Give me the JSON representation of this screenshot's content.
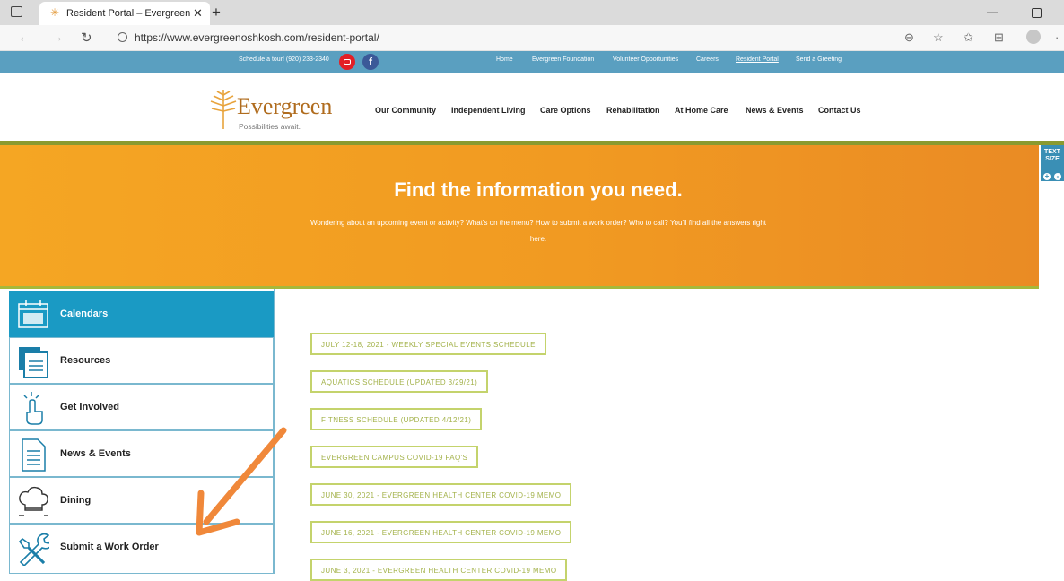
{
  "browser": {
    "tab_title": "Resident Portal – Evergreen",
    "url": "https://www.evergreenoshkosh.com/resident-portal/"
  },
  "utility": {
    "tour": "Schedule a tour! (920) 233-2340",
    "links": [
      "Home",
      "Evergreen Foundation",
      "Volunteer Opportunities",
      "Careers",
      "Resident Portal",
      "Send a Greeting"
    ]
  },
  "header": {
    "logo": "Evergreen",
    "tagline": "Possibilities await.",
    "nav": [
      "Our Community",
      "Independent Living",
      "Care Options",
      "Rehabilitation",
      "At Home Care",
      "News & Events",
      "Contact Us"
    ]
  },
  "banner": {
    "title": "Find the information you need.",
    "subtitle": "Wondering about an upcoming event or activity? What's on the menu? How to submit a work order? Who to call? You'll find all the answers right here.",
    "text_size_label": "TEXT SIZE"
  },
  "sidebar": {
    "items": [
      "Calendars",
      "Resources",
      "Get Involved",
      "News & Events",
      "Dining",
      "Submit a Work Order"
    ]
  },
  "documents": [
    "JULY 12-18, 2021 - WEEKLY SPECIAL EVENTS SCHEDULE",
    "AQUATICS SCHEDULE (UPDATED 3/29/21)",
    "FITNESS SCHEDULE (UPDATED 4/12/21)",
    "EVERGREEN CAMPUS COVID-19 FAQ'S",
    "JUNE 30, 2021 - EVERGREEN HEALTH CENTER COVID-19 MEMO",
    "JUNE 16, 2021 - EVERGREEN HEALTH CENTER COVID-19 MEMO",
    "JUNE 3, 2021 - EVERGREEN HEALTH CENTER COVID-19 MEMO"
  ],
  "colors": {
    "banner_orange": "#f19a22",
    "utility_blue": "#5a9fc0",
    "sidebar_active": "#1a9ac4",
    "button_green": "#c4d36c",
    "annotation_arrow": "#f0883a"
  }
}
